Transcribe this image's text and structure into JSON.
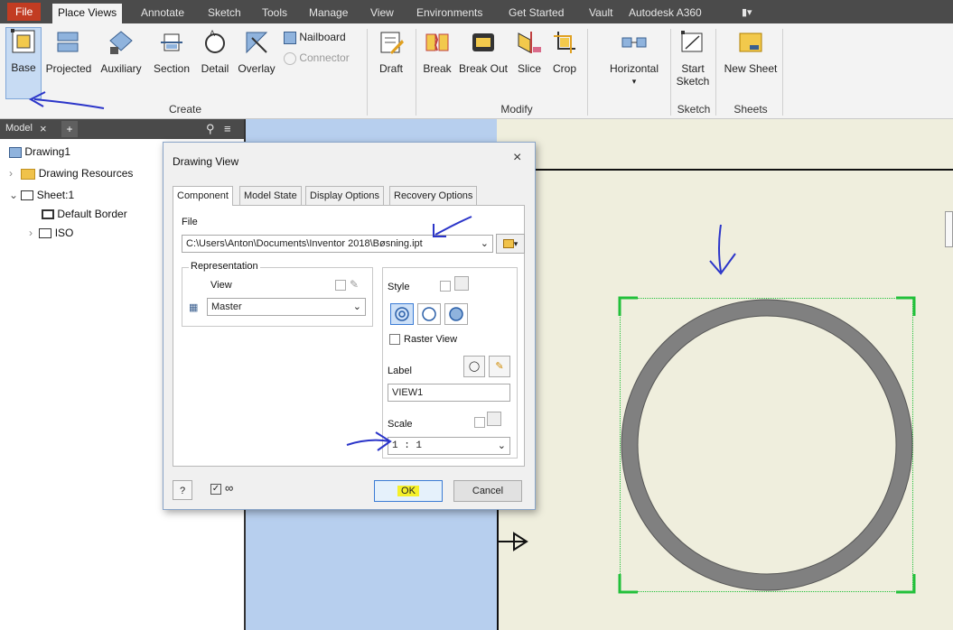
{
  "menu": {
    "tabs": [
      "File",
      "Place Views",
      "Annotate",
      "Sketch",
      "Tools",
      "Manage",
      "View",
      "Environments",
      "Get Started",
      "Vault",
      "Autodesk A360"
    ],
    "active": "Place Views"
  },
  "ribbon": {
    "create": {
      "base": "Base",
      "projected": "Projected",
      "auxiliary": "Auxiliary",
      "section": "Section",
      "detail": "Detail",
      "overlay": "Overlay",
      "nailboard": "Nailboard",
      "connector": "Connector",
      "label": "Create"
    },
    "draft": "Draft",
    "modify": {
      "break": "Break",
      "break_out": "Break Out",
      "slice": "Slice",
      "crop": "Crop",
      "label": "Modify"
    },
    "horizontal": "Horizontal",
    "sketch": {
      "start_1": "Start",
      "start_2": "Sketch",
      "label": "Sketch"
    },
    "sheets": {
      "new_sheet": "New Sheet",
      "label": "Sheets"
    }
  },
  "browser": {
    "tab": "Model",
    "tree": {
      "drawing": "Drawing1",
      "resources": "Drawing Resources",
      "sheet": "Sheet:1",
      "border": "Default Border",
      "iso": "ISO"
    }
  },
  "dialog": {
    "title": "Drawing View",
    "tabs": [
      "Component",
      "Model State",
      "Display Options",
      "Recovery Options"
    ],
    "file_label": "File",
    "file_path": "C:\\Users\\Anton\\Documents\\Inventor 2018\\Bøsning.ipt",
    "representation_label": "Representation",
    "view_label": "View",
    "view_value": "Master",
    "style_label": "Style",
    "raster_label": "Raster View",
    "label_label": "Label",
    "label_value": "VIEW1",
    "scale_label": "Scale",
    "scale_value": "1 : 1",
    "ok": "OK",
    "cancel": "Cancel"
  },
  "colors": {
    "accent_red": "#c23c22",
    "annotation_blue": "#2b35c9",
    "ok_highlight": "#f5f02a",
    "canvas_blue": "#b7cfee",
    "sheet": "#efeedd",
    "selection_green": "#22c03a"
  }
}
